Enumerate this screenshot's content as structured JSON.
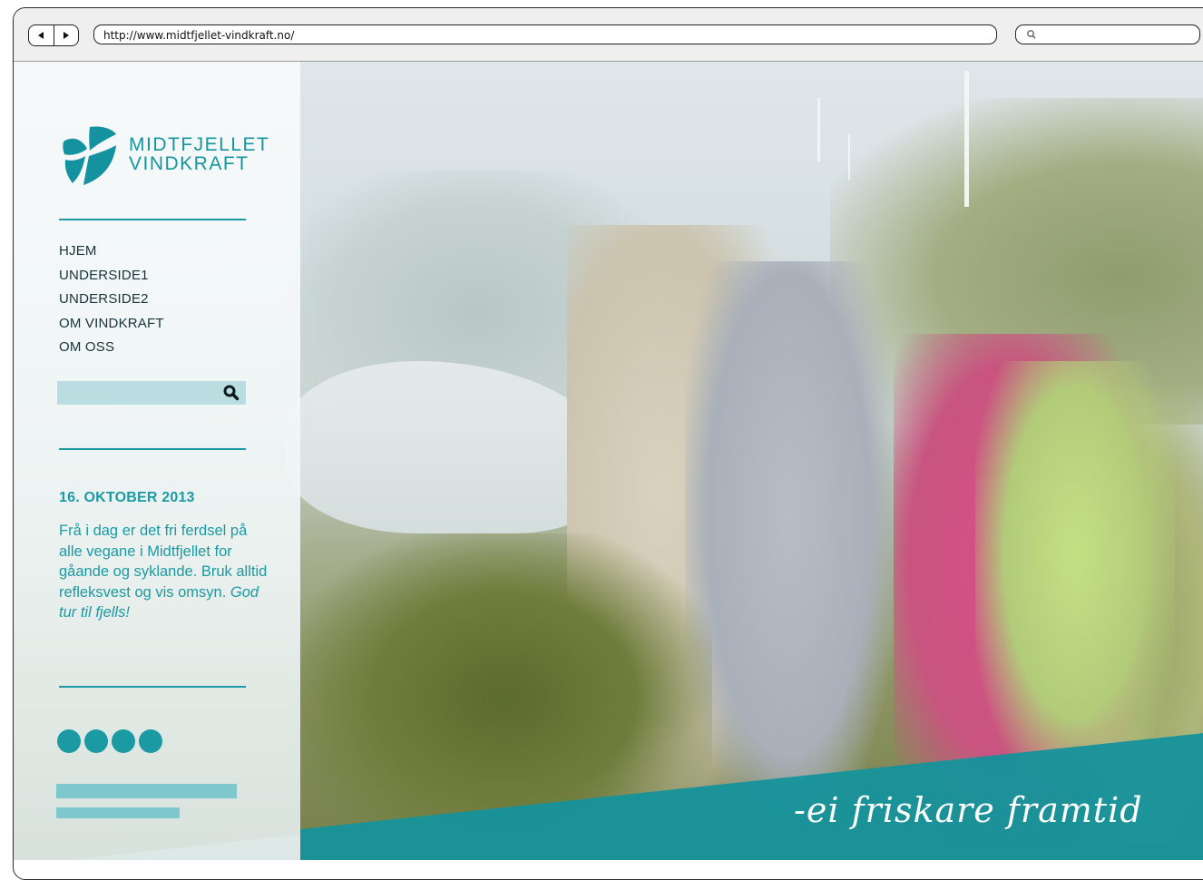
{
  "browser": {
    "url": "http://www.midtfjellet-vindkraft.no/",
    "back_icon": "arrow-left-icon",
    "forward_icon": "arrow-right-icon",
    "search_icon": "search-icon"
  },
  "site": {
    "logo": {
      "line1": "MIDTFJELLET",
      "line2": "VINDKRAFT"
    },
    "menu": [
      {
        "label": "HJEM"
      },
      {
        "label": "UNDERSIDE1"
      },
      {
        "label": "UNDERSIDE2"
      },
      {
        "label": "OM VINDKRAFT"
      },
      {
        "label": "OM OSS"
      }
    ],
    "search": {
      "icon": "search-icon"
    },
    "news": {
      "date": "16. OKTOBER 2013",
      "body": "Frå i dag er det fri ferdsel på alle vegane i Midtfjellet for gåande og syklande. Bruk alltid refleksvest og vis omsyn.",
      "closing": "God tur til fjells!"
    },
    "social_icons": [
      "twitter-icon",
      "vimeo-icon",
      "facebook-icon",
      "instagram-icon"
    ],
    "tagline": "-ei friskare framtid",
    "colors": {
      "accent": "#1b9aa3",
      "accent_light": "#7ec7cd",
      "search_bg": "#b9dde0",
      "menu_text": "#173338"
    }
  }
}
